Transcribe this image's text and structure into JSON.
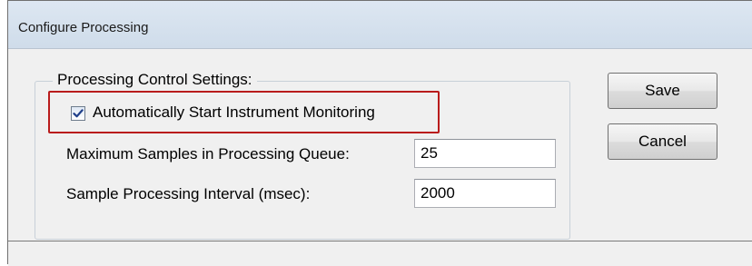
{
  "window": {
    "title": "Configure Processing"
  },
  "group": {
    "title": "Processing Control Settings:",
    "auto_start": {
      "label": "Automatically Start Instrument Monitoring",
      "checked": true
    },
    "max_samples": {
      "label": "Maximum Samples in Processing Queue:",
      "value": "25"
    },
    "interval": {
      "label": "Sample Processing Interval (msec):",
      "value": "2000"
    }
  },
  "buttons": {
    "save_label": "Save",
    "cancel_label": "Cancel"
  },
  "colors": {
    "highlight_border": "#b91c1c",
    "check_mark": "#1f3f8a"
  },
  "icons": {
    "checkbox": "check-mark-icon"
  }
}
